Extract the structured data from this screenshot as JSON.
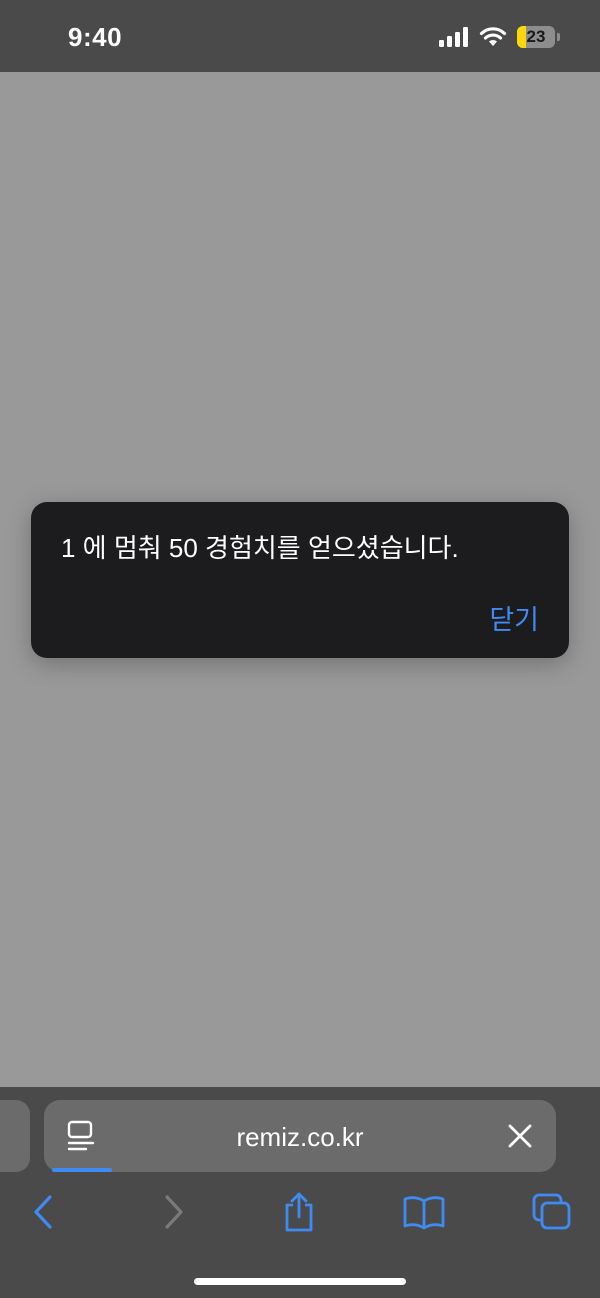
{
  "status_bar": {
    "time": "9:40",
    "battery_level": "23",
    "battery_fraction": 0.23,
    "icons": [
      "cellular-signal-icon",
      "wifi-icon",
      "battery-icon"
    ]
  },
  "dialog": {
    "message": "1 에 멈춰 50 경험치를 얻으셨습니다.",
    "close_label": "닫기"
  },
  "browser": {
    "url": "remiz.co.kr",
    "toolbar_icons": [
      "back-icon",
      "forward-icon",
      "share-icon",
      "bookmarks-icon",
      "tabs-icon"
    ]
  },
  "colors": {
    "accent": "#3f8bf4",
    "dialog_bg": "#1c1c1e",
    "page_overlay": "#999999",
    "bar_bg": "#4a4a4a",
    "battery_fill": "#ffd60a"
  }
}
